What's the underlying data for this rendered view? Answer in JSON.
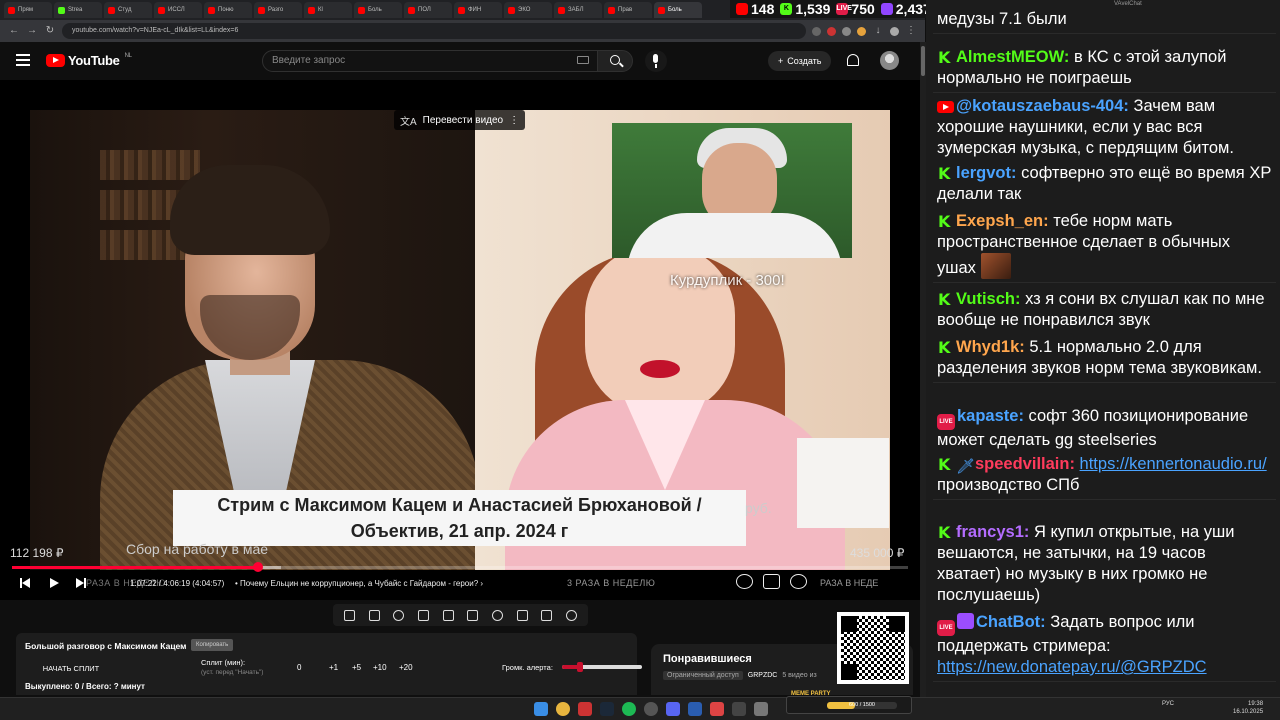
{
  "browser": {
    "tabs": [
      {
        "label": "Прям",
        "color": "#ff0000"
      },
      {
        "label": "Strea",
        "color": "#53fc18"
      },
      {
        "label": "Студ",
        "color": "#ff0000"
      },
      {
        "label": "ИССЛ",
        "color": "#ff0000"
      },
      {
        "label": "Поню",
        "color": "#ff0000"
      },
      {
        "label": "Разго",
        "color": "#ff0000"
      },
      {
        "label": "Кl",
        "color": "#ff0000"
      },
      {
        "label": "Боль",
        "color": "#ff0000"
      },
      {
        "label": "ПОЛ",
        "color": "#ff0000"
      },
      {
        "label": "ФИН",
        "color": "#ff0000"
      },
      {
        "label": "ЭКО",
        "color": "#ff0000"
      },
      {
        "label": "ЗАБЛ",
        "color": "#ff0000"
      },
      {
        "label": "Прав",
        "color": "#ff0000"
      },
      {
        "label": "Боль",
        "color": "#ff0000",
        "active": true
      }
    ],
    "url": "youtube.com/watch?v=NJEa-cL_dIk&list=LL&index=6",
    "stats": {
      "youtube": "148",
      "kick": "1,539",
      "live": "750",
      "twitch": "2,437"
    }
  },
  "youtube": {
    "region": "NL",
    "logo_text": "YouTube",
    "search_placeholder": "Введите запрос",
    "create_label": "Создать"
  },
  "video": {
    "translate_label": "Перевести видео",
    "overlay_label": "Курдуплик - 300!",
    "title_line1": "Стрим с Максимом Кацем и Анастасией Брюхановой /",
    "title_line2": "Объектив, 21 апр. 2024 г",
    "banner_side_text": "руб.",
    "left_amount": "112 198 ₽",
    "goal_text": "Сбор на работу в мае",
    "right_amount": "435 000 ₽",
    "progress_fraction": 0.275,
    "buffer_fraction": 0.3,
    "timecode": "1:07:22 / 4:06:19 (4:04:57)",
    "chapter": "• Почему Ельцин не коррупционер, а Чубайс с Гайдаром - герои? ›",
    "ticker_mid": "3 РАЗА В НЕДЕЛЮ",
    "ticker_left": "РАЗА В НЕДЕЛЮ",
    "ticker_right": "РАЗА В НЕДЕ"
  },
  "widget": {
    "title": "Большой разговор с Максимом Кацем",
    "copy_label": "Копировать",
    "start_split": "НАЧАТЬ СПЛИТ",
    "split_label": "Сплит (мин):",
    "split_sub": "(уст. перед \"Начать\")",
    "split_values": [
      "0",
      "+1",
      "+5",
      "+10",
      "+20"
    ],
    "alert_label": "Громк. алерта:",
    "alert_level": 0.22,
    "bought": "Выкуплено: 0 / Всего: ? минут"
  },
  "liked": {
    "title": "Понравившиеся",
    "restricted": "Ограниченный доступ",
    "owner": "GRPZDC",
    "count": "5 видео из"
  },
  "chat": {
    "title": "VAvelChat",
    "messages": [
      {
        "badge": "none",
        "user": "",
        "user_color": "#ffffff",
        "text": "медузы 7.1 были"
      },
      {
        "badge": "kick",
        "user": "AlmestMEOW:",
        "user_color": "#53fc18",
        "text": "в КС с этой залупой нормально не поиграешь"
      },
      {
        "badge": "yt",
        "user": "@kotauszaebaus-404:",
        "user_color": "#4aa3ff",
        "text": "Зачем вам хорошие наушники, если у вас вся зумерская музыка, с пердящим битом."
      },
      {
        "badge": "kick",
        "user": "lergvot:",
        "user_color": "#4aa3ff",
        "text": "софтверно это ещё во время XP делали так"
      },
      {
        "badge": "kick",
        "user": "Exepsh_en:",
        "user_color": "#ffa64d",
        "text": "тебе норм мать пространственное сделает в обычных ушах"
      },
      {
        "badge": "kick",
        "user": "Vutisch:",
        "user_color": "#53fc18",
        "text": "хз я сони вх слушал как по мне вообще не понравился звук"
      },
      {
        "badge": "kick",
        "user": "Whyd1k:",
        "user_color": "#ffa64d",
        "text": "5.1 нормально 2.0 для разделения звуков норм тема звуковикам."
      },
      {
        "badge": "live",
        "user": "kapaste:",
        "user_color": "#4aa3ff",
        "text": "софт 360 позиционирование может сделать gg steelseries"
      },
      {
        "badge": "kick",
        "user": "speedvillain:",
        "user_color": "#ff3b5c",
        "link": "https://kennertonaudio.ru/",
        "text": "производство СПб"
      },
      {
        "badge": "kick",
        "user": "francys1:",
        "user_color": "#b46cff",
        "text": "Я купил открытые, на уши вешаются, не затычки, на 19 часов хватает) но музыку в них громко не послушаешь)"
      },
      {
        "badge": "live",
        "user": "ChatBot:",
        "user_color": "#4aa3ff",
        "text": "Задать вопрос или поддержать стримера:",
        "link": "https://new.donatepay.ru/@GRPZDC"
      }
    ]
  },
  "taskbar": {
    "tray": "РУС",
    "time": "19:38",
    "date": "16.10.2025",
    "meme_label": "MEME PARTY",
    "meme_count": "600 / 1500",
    "meme_fraction": 0.4
  }
}
